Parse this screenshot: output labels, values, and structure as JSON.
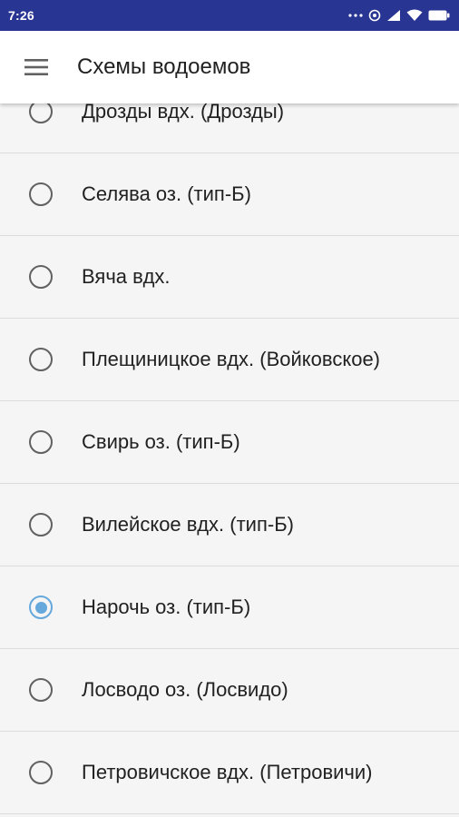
{
  "status_bar": {
    "time": "7:26",
    "icons": [
      "more-dots-icon",
      "hotspot-icon",
      "signal-icon",
      "wifi-icon",
      "battery-icon"
    ]
  },
  "app_bar": {
    "menu_icon": "hamburger-menu-icon",
    "title": "Схемы водоемов"
  },
  "reservoirs": [
    {
      "label": "Дрозды вдх. (Дрозды)",
      "selected": false
    },
    {
      "label": "Селява оз. (тип-Б)",
      "selected": false
    },
    {
      "label": "Вяча вдх.",
      "selected": false
    },
    {
      "label": "Плещиницкое вдх. (Войковское)",
      "selected": false
    },
    {
      "label": "Свирь оз. (тип-Б)",
      "selected": false
    },
    {
      "label": "Вилейское вдх. (тип-Б)",
      "selected": false
    },
    {
      "label": "Нарочь оз. (тип-Б)",
      "selected": true
    },
    {
      "label": "Лосводо оз. (Лосвидо)",
      "selected": false
    },
    {
      "label": "Петровичское вдх. (Петровичи)",
      "selected": false
    }
  ],
  "colors": {
    "status_bar": "#283593",
    "radio_selected": "#64a8dc",
    "radio_unselected": "#616161",
    "background": "#f5f5f5"
  }
}
